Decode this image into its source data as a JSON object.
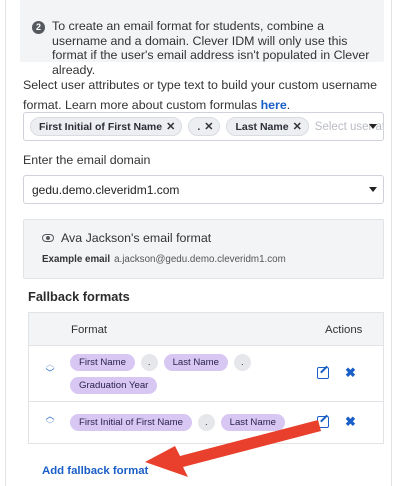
{
  "info": {
    "step_number": "2",
    "text": "To create an email format for students, combine a username and a domain. Clever IDM will only use this format if the user's email address isn't populated in Clever already."
  },
  "lead": {
    "text": "Select user attributes or type text to build your custom username format. Learn more about custom formulas ",
    "link": "here",
    "tail": "."
  },
  "username_select": {
    "tags": [
      "First Initial of First Name",
      ".",
      "Last Name"
    ],
    "placeholder": "Select user att"
  },
  "domain": {
    "label": "Enter the email domain",
    "value": "gedu.demo.cleveridm1.com"
  },
  "preview": {
    "title": "Ava Jackson's email format",
    "example_label": "Example email",
    "example_value": "a.jackson@gedu.demo.cleveridm1.com"
  },
  "fallback": {
    "title": "Fallback formats",
    "columns": [
      "Format",
      "Actions"
    ],
    "rows": [
      {
        "chips": [
          "First Name",
          ".",
          "Last Name",
          ".",
          "Graduation Year"
        ]
      },
      {
        "chips": [
          "First Initial of First Name",
          ".",
          "Last Name"
        ]
      }
    ],
    "add_label": "Add fallback format"
  },
  "colors": {
    "link": "#1a5ec8",
    "chip": "#d7c7f2",
    "annotation_arrow": "#e8402c"
  },
  "icons": [
    "info-number-icon",
    "remove-tag-icon",
    "dropdown-caret-icon",
    "eye-icon",
    "move-up-icon",
    "move-down-icon",
    "edit-icon",
    "delete-icon",
    "annotation-arrow"
  ]
}
